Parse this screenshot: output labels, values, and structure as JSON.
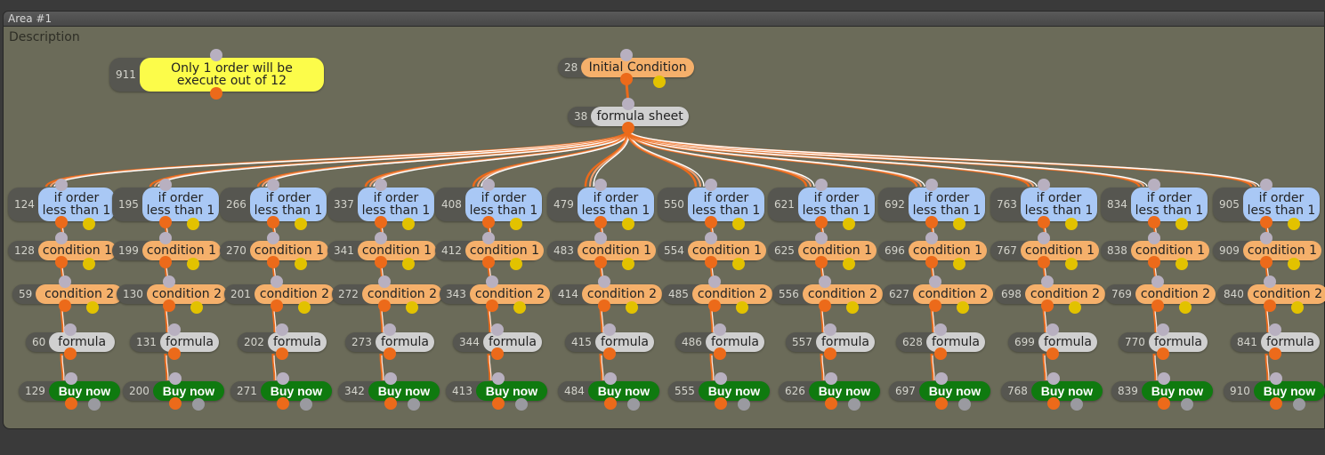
{
  "area": {
    "title": "Area #1",
    "description": "Description"
  },
  "note": {
    "id": "911",
    "text": "Only 1 order will be execute out of 12"
  },
  "root": {
    "id": "28",
    "label": "Initial Condition"
  },
  "sheet": {
    "id": "38",
    "label": "formula sheet"
  },
  "columns": [
    {
      "check": {
        "id": "124",
        "label": "if order less than 1"
      },
      "cond1": {
        "id": "128",
        "label": "condition 1"
      },
      "cond2": {
        "id": "59",
        "label": "condition 2"
      },
      "formula": {
        "id": "60",
        "label": "formula"
      },
      "buy": {
        "id": "129",
        "label": "Buy now"
      }
    },
    {
      "check": {
        "id": "195",
        "label": "if order less than 1"
      },
      "cond1": {
        "id": "199",
        "label": "condition 1"
      },
      "cond2": {
        "id": "130",
        "label": "condition 2"
      },
      "formula": {
        "id": "131",
        "label": "formula"
      },
      "buy": {
        "id": "200",
        "label": "Buy now"
      }
    },
    {
      "check": {
        "id": "266",
        "label": "if order less than 1"
      },
      "cond1": {
        "id": "270",
        "label": "condition 1"
      },
      "cond2": {
        "id": "201",
        "label": "condition 2"
      },
      "formula": {
        "id": "202",
        "label": "formula"
      },
      "buy": {
        "id": "271",
        "label": "Buy now"
      }
    },
    {
      "check": {
        "id": "337",
        "label": "if order less than 1"
      },
      "cond1": {
        "id": "341",
        "label": "condition 1"
      },
      "cond2": {
        "id": "272",
        "label": "condition 2"
      },
      "formula": {
        "id": "273",
        "label": "formula"
      },
      "buy": {
        "id": "342",
        "label": "Buy now"
      }
    },
    {
      "check": {
        "id": "408",
        "label": "if order less than 1"
      },
      "cond1": {
        "id": "412",
        "label": "condition 1"
      },
      "cond2": {
        "id": "343",
        "label": "condition 2"
      },
      "formula": {
        "id": "344",
        "label": "formula"
      },
      "buy": {
        "id": "413",
        "label": "Buy now"
      }
    },
    {
      "check": {
        "id": "479",
        "label": "if order less than 1"
      },
      "cond1": {
        "id": "483",
        "label": "condition 1"
      },
      "cond2": {
        "id": "414",
        "label": "condition 2"
      },
      "formula": {
        "id": "415",
        "label": "formula"
      },
      "buy": {
        "id": "484",
        "label": "Buy now"
      }
    },
    {
      "check": {
        "id": "550",
        "label": "if order less than 1"
      },
      "cond1": {
        "id": "554",
        "label": "condition 1"
      },
      "cond2": {
        "id": "485",
        "label": "condition 2"
      },
      "formula": {
        "id": "486",
        "label": "formula"
      },
      "buy": {
        "id": "555",
        "label": "Buy now"
      }
    },
    {
      "check": {
        "id": "621",
        "label": "if order less than 1"
      },
      "cond1": {
        "id": "625",
        "label": "condition 1"
      },
      "cond2": {
        "id": "556",
        "label": "condition 2"
      },
      "formula": {
        "id": "557",
        "label": "formula"
      },
      "buy": {
        "id": "626",
        "label": "Buy now"
      }
    },
    {
      "check": {
        "id": "692",
        "label": "if order less than 1"
      },
      "cond1": {
        "id": "696",
        "label": "condition 1"
      },
      "cond2": {
        "id": "627",
        "label": "condition 2"
      },
      "formula": {
        "id": "628",
        "label": "formula"
      },
      "buy": {
        "id": "697",
        "label": "Buy now"
      }
    },
    {
      "check": {
        "id": "763",
        "label": "if order less than 1"
      },
      "cond1": {
        "id": "767",
        "label": "condition 1"
      },
      "cond2": {
        "id": "698",
        "label": "condition 2"
      },
      "formula": {
        "id": "699",
        "label": "formula"
      },
      "buy": {
        "id": "768",
        "label": "Buy now"
      }
    },
    {
      "check": {
        "id": "834",
        "label": "if order less than 1"
      },
      "cond1": {
        "id": "838",
        "label": "condition 1"
      },
      "cond2": {
        "id": "769",
        "label": "condition 2"
      },
      "formula": {
        "id": "770",
        "label": "formula"
      },
      "buy": {
        "id": "839",
        "label": "Buy now"
      }
    },
    {
      "check": {
        "id": "905",
        "label": "if order less than 1"
      },
      "cond1": {
        "id": "909",
        "label": "condition 1"
      },
      "cond2": {
        "id": "840",
        "label": "condition 2"
      },
      "formula": {
        "id": "841",
        "label": "formula"
      },
      "buy": {
        "id": "910",
        "label": "Buy now"
      }
    }
  ],
  "colors": {
    "panel": "#6b6b59",
    "condition": "#f5b06b",
    "formula": "#d0d0d0",
    "check": "#a9c8f5",
    "note": "#fcfc4a",
    "buy": "#0f7a0f",
    "wire": "#ec6a1a"
  }
}
